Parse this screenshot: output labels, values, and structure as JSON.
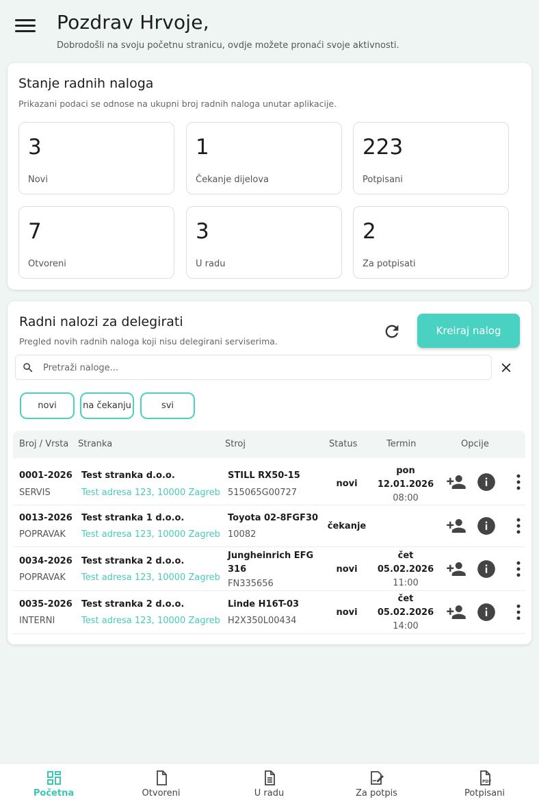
{
  "header": {
    "greeting": "Pozdrav Hrvoje,",
    "subtitle": "Dobrodošli na svoju početnu stranicu, ovdje možete pronaći svoje aktivnosti."
  },
  "stats": {
    "title": "Stanje radnih naloga",
    "subtitle": "Prikazani podaci se odnose na ukupni broj radnih naloga unutar aplikacije.",
    "items": [
      {
        "value": "3",
        "label": "Novi"
      },
      {
        "value": "1",
        "label": "Čekanje dijelova"
      },
      {
        "value": "223",
        "label": "Potpisani"
      },
      {
        "value": "7",
        "label": "Otvoreni"
      },
      {
        "value": "3",
        "label": "U radu"
      },
      {
        "value": "2",
        "label": "Za potpisati"
      }
    ]
  },
  "orders": {
    "title": "Radni nalozi za delegirati",
    "subtitle": "Pregled novih radnih naloga koji nisu delegirani serviserima.",
    "create_label": "Kreiraj nalog",
    "search_placeholder": "Pretraži naloge...",
    "filters": [
      "novi",
      "na čekanju",
      "svi"
    ],
    "columns": [
      "Broj / Vrsta",
      "Stranka",
      "Stroj",
      "Status",
      "Termin",
      "Opcije"
    ],
    "rows": [
      {
        "number": "0001-2026",
        "type": "SERVIS",
        "client": "Test stranka d.o.o.",
        "address": "Test adresa 123, 10000 Zagreb",
        "machine": "STILL RX50-15",
        "serial": "515065G00727",
        "status": "novi",
        "day": "pon",
        "date": "12.01.2026",
        "time": "08:00"
      },
      {
        "number": "0013-2026",
        "type": "POPRAVAK",
        "client": "Test stranka 1 d.o.o.",
        "address": "Test adresa 123, 10000 Zagreb",
        "machine": "Toyota 02-8FGF30",
        "serial": "10082",
        "status": "čekanje",
        "day": "",
        "date": "",
        "time": ""
      },
      {
        "number": "0034-2026",
        "type": "POPRAVAK",
        "client": "Test stranka 2 d.o.o.",
        "address": "Test adresa 123, 10000 Zagreb",
        "machine": "Jungheinrich EFG 316",
        "serial": "FN335656",
        "status": "novi",
        "day": "čet",
        "date": "05.02.2026",
        "time": "11:00"
      },
      {
        "number": "0035-2026",
        "type": "INTERNI",
        "client": "Test stranka 2 d.o.o.",
        "address": "Test adresa 123, 10000 Zagreb",
        "machine": "Linde H16T-03",
        "serial": "H2X350L00434",
        "status": "novi",
        "day": "čet",
        "date": "05.02.2026",
        "time": "14:00"
      }
    ]
  },
  "nav": {
    "items": [
      {
        "label": "Početna",
        "icon": "dashboard-icon"
      },
      {
        "label": "Otvoreni",
        "icon": "document-icon"
      },
      {
        "label": "U radu",
        "icon": "document-lines-icon"
      },
      {
        "label": "Za potpis",
        "icon": "signature-icon"
      },
      {
        "label": "Potpisani",
        "icon": "pdf-icon"
      }
    ],
    "active_color": "#3cc5b4"
  },
  "colors": {
    "accent": "#49d1c2",
    "background": "#eef5f3"
  }
}
